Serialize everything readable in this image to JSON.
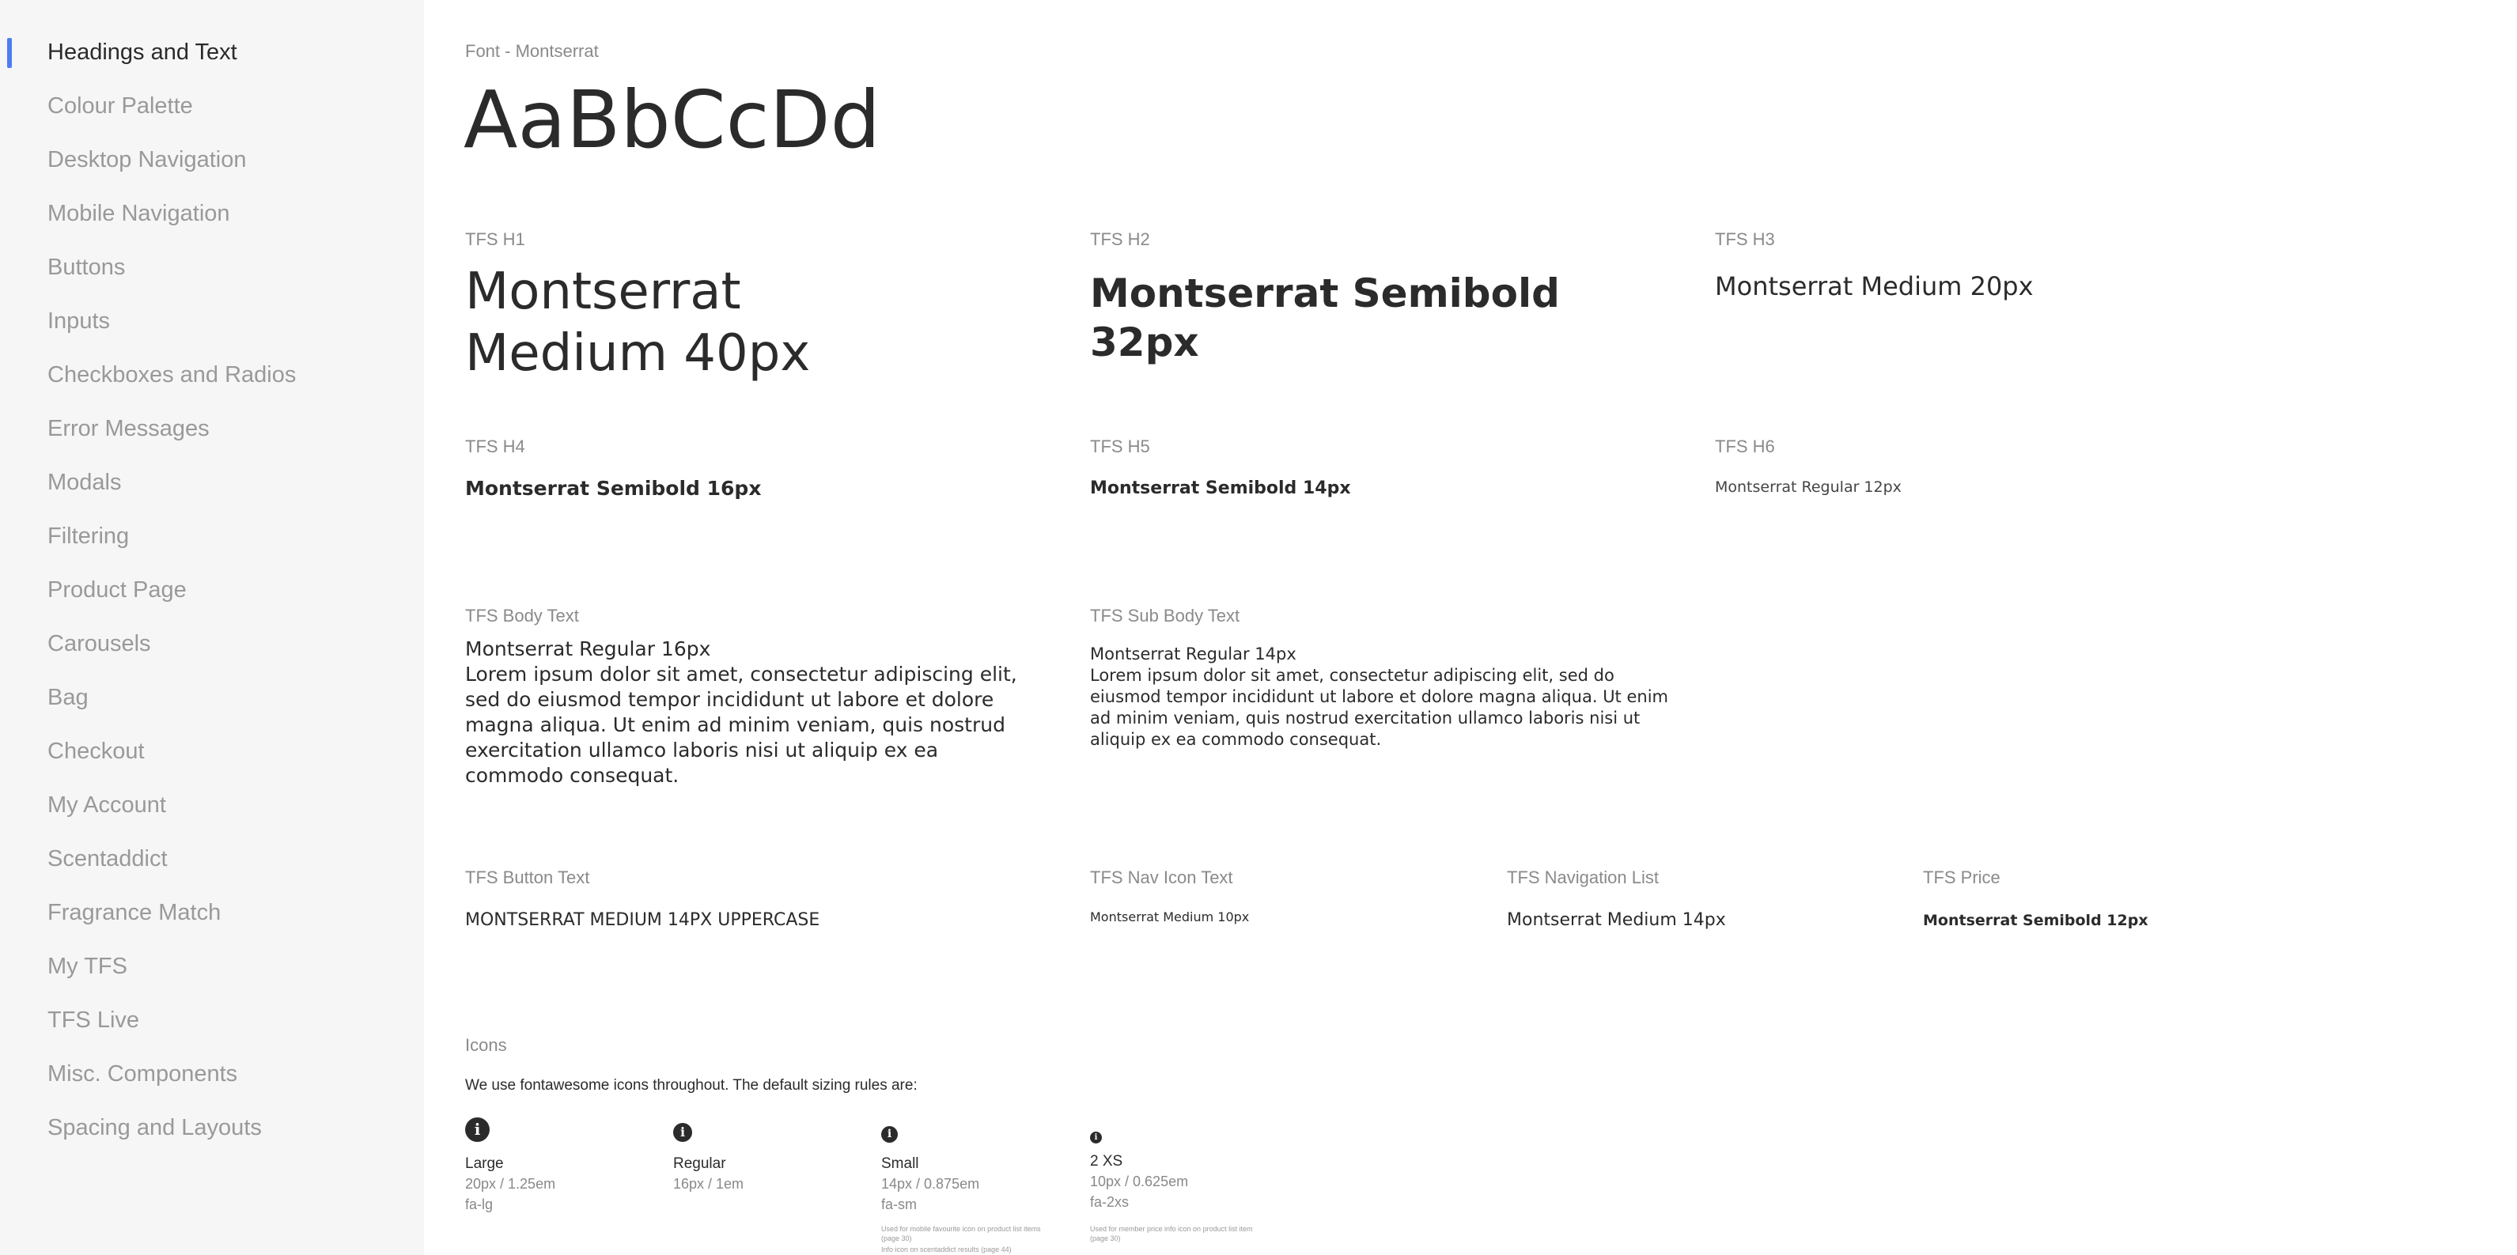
{
  "sidebar": {
    "items": [
      {
        "label": "Headings and Text"
      },
      {
        "label": "Colour Palette"
      },
      {
        "label": "Desktop Navigation"
      },
      {
        "label": "Mobile Navigation"
      },
      {
        "label": "Buttons"
      },
      {
        "label": "Inputs"
      },
      {
        "label": "Checkboxes and Radios"
      },
      {
        "label": "Error Messages"
      },
      {
        "label": "Modals"
      },
      {
        "label": "Filtering"
      },
      {
        "label": "Product Page"
      },
      {
        "label": "Carousels"
      },
      {
        "label": "Bag"
      },
      {
        "label": "Checkout"
      },
      {
        "label": "My Account"
      },
      {
        "label": "Scentaddict"
      },
      {
        "label": "Fragrance Match"
      },
      {
        "label": "My TFS"
      },
      {
        "label": "TFS Live"
      },
      {
        "label": "Misc. Components"
      },
      {
        "label": "Spacing and Layouts"
      }
    ],
    "active_index": 0
  },
  "font": {
    "label": "Font - Montserrat",
    "sample": "AaBbCcDd"
  },
  "headings": {
    "h1": {
      "label": "TFS H1",
      "sample": "Montserrat Medium 40px"
    },
    "h2": {
      "label": "TFS H2",
      "sample": "Montserrat Semibold 32px"
    },
    "h3": {
      "label": "TFS H3",
      "sample": "Montserrat Medium 20px"
    },
    "h4": {
      "label": "TFS H4",
      "sample": "Montserrat Semibold 16px"
    },
    "h5": {
      "label": "TFS H5",
      "sample": "Montserrat Semibold 14px"
    },
    "h6": {
      "label": "TFS H6",
      "sample": "Montserrat Regular 12px"
    }
  },
  "body_text": {
    "label": "TFS Body Text",
    "title": "Montserrat Regular 16px",
    "text": "Lorem ipsum dolor sit amet, consectetur adipiscing elit, sed do eiusmod tempor incididunt ut labore et dolore magna aliqua. Ut enim ad minim veniam, quis nostrud exercitation ullamco laboris nisi ut aliquip ex ea commodo consequat."
  },
  "sub_body_text": {
    "label": "TFS Sub Body Text",
    "title": "Montserrat Regular 14px",
    "text": "Lorem ipsum dolor sit amet, consectetur adipiscing elit, sed do eiusmod tempor incididunt ut labore et dolore magna aliqua. Ut enim ad minim veniam, quis nostrud exercitation ullamco laboris nisi ut aliquip ex ea commodo consequat."
  },
  "button_text": {
    "label": "TFS Button Text",
    "sample": "MONTSERRAT MEDIUM 14PX UPPERCASE"
  },
  "nav_icon_text": {
    "label": "TFS Nav Icon Text",
    "sample": "Montserrat Medium 10px"
  },
  "navigation_list": {
    "label": "TFS Navigation List",
    "sample": "Montserrat Medium 14px"
  },
  "price": {
    "label": "TFS Price",
    "sample": "Montserrat Semibold 12px"
  },
  "icons": {
    "label": "Icons",
    "intro": "We use fontawesome icons throughout. The default sizing rules are:",
    "icon_glyph": "i",
    "sizes": [
      {
        "name": "Large",
        "size": "20px / 1.25em",
        "class": "fa-lg"
      },
      {
        "name": "Regular",
        "size": "16px / 1em",
        "class": "fa-sm"
      },
      {
        "name": "Small",
        "size": "14px / 0.875em",
        "class": "fa-sm",
        "note1": "Used for mobile favourite icon on product list items (page 30)",
        "note2": "Info icon on scentaddict results (page 44)"
      },
      {
        "name": "2 XS",
        "size": "10px / 0.625em",
        "class": "fa-2xs",
        "note1": "Used for member price info icon on product list item (page 30)"
      }
    ]
  },
  "colors": {
    "accent": "#4d7cf4",
    "sidebar_bg": "#f6f6f6",
    "text_dark": "#2b2b2b",
    "text_muted": "#8a8a8a"
  }
}
